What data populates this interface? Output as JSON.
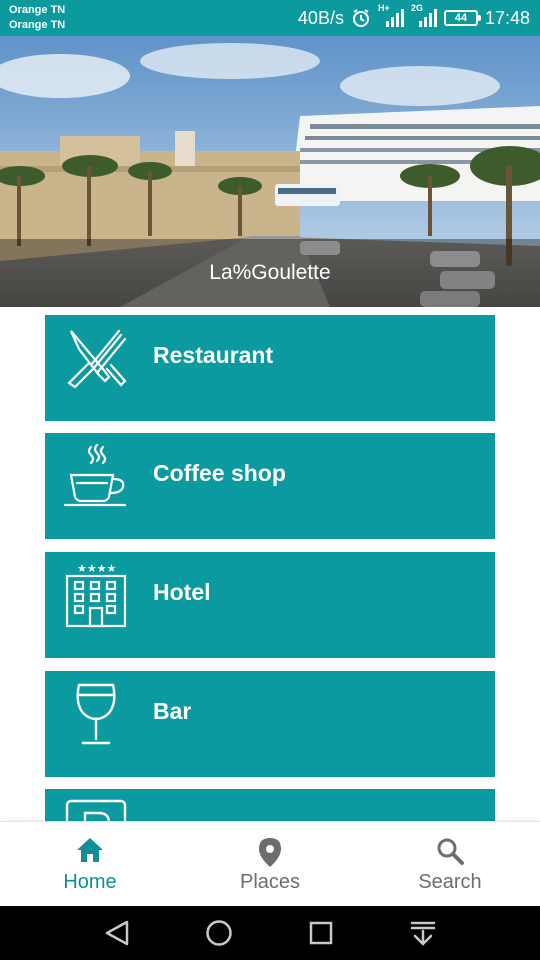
{
  "status_bar": {
    "carrier_1": "Orange TN",
    "carrier_2": "Orange TN",
    "net_speed": "40B/s",
    "network_1": "H+",
    "network_2": "2G",
    "battery": "44",
    "time": "17:48",
    "icons": [
      "alarm-icon",
      "signal-icon",
      "signal-icon",
      "battery-icon"
    ]
  },
  "hero": {
    "title": "La%Goulette"
  },
  "categories": [
    {
      "label": "Restaurant",
      "icon": "fork-knife-icon"
    },
    {
      "label": "Coffee shop",
      "icon": "coffee-cup-icon"
    },
    {
      "label": "Hotel",
      "icon": "hotel-icon"
    },
    {
      "label": "Bar",
      "icon": "wine-glass-icon"
    },
    {
      "label": "",
      "icon": "parking-icon"
    }
  ],
  "bottom_nav": {
    "items": [
      {
        "label": "Home",
        "icon": "home-icon",
        "active": true
      },
      {
        "label": "Places",
        "icon": "location-pin-icon",
        "active": false
      },
      {
        "label": "Search",
        "icon": "search-icon",
        "active": false
      }
    ]
  },
  "colors": {
    "primary": "#0d9a9f",
    "card": "#0b9aa0",
    "active_nav": "#0d8f95",
    "inactive_nav": "#6d6d6d"
  }
}
